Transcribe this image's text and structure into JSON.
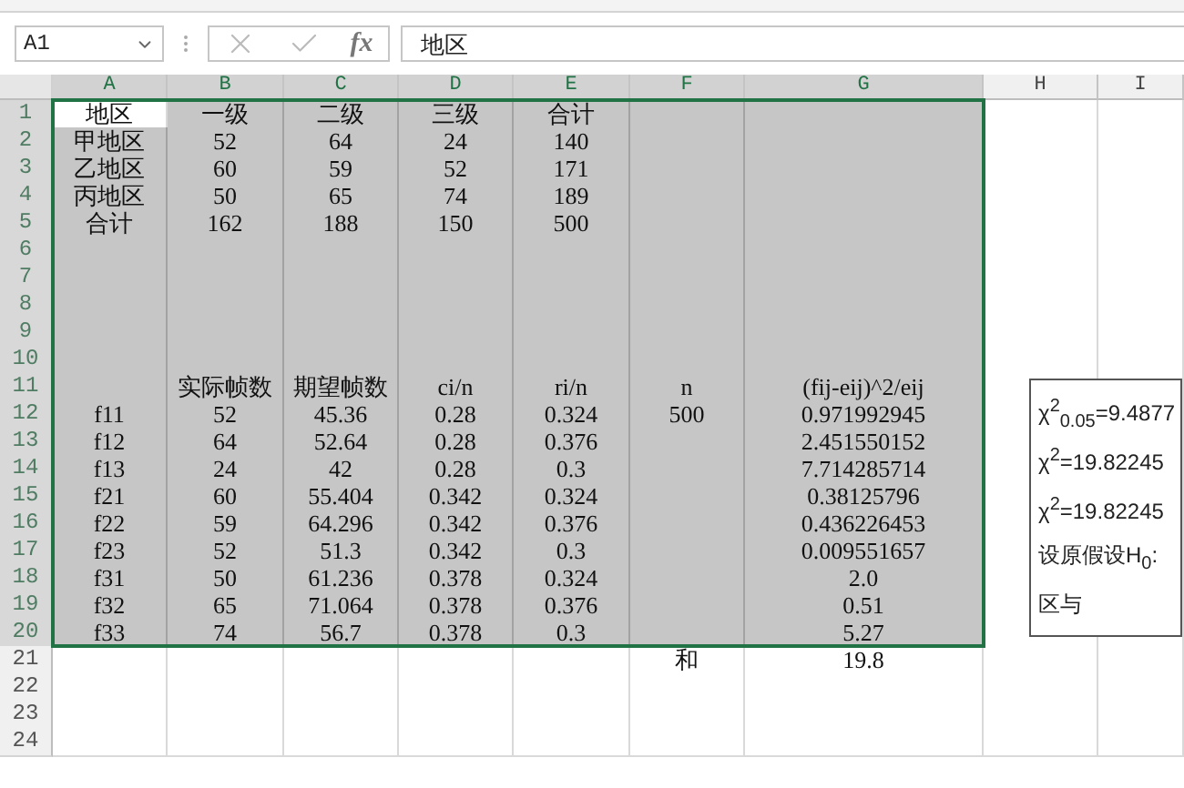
{
  "formula_bar": {
    "name_box": "A1",
    "fx_label": "fx",
    "formula": "地区"
  },
  "columns": [
    {
      "label": "A",
      "selected": true,
      "active": true
    },
    {
      "label": "B",
      "selected": true,
      "active": false
    },
    {
      "label": "C",
      "selected": true,
      "active": false
    },
    {
      "label": "D",
      "selected": true,
      "active": false
    },
    {
      "label": "E",
      "selected": true,
      "active": false
    },
    {
      "label": "F",
      "selected": true,
      "active": false
    },
    {
      "label": "G",
      "selected": true,
      "active": false
    },
    {
      "label": "H",
      "selected": false,
      "active": false
    },
    {
      "label": "I",
      "selected": false,
      "active": false
    }
  ],
  "rows": [
    {
      "number": "1",
      "selected": true,
      "active": true,
      "cells": {
        "A": "地区",
        "B": "一级",
        "C": "二级",
        "D": "三级",
        "E": "合计"
      }
    },
    {
      "number": "2",
      "selected": true,
      "cells": {
        "A": "甲地区",
        "B": "52",
        "C": "64",
        "D": "24",
        "E": "140"
      }
    },
    {
      "number": "3",
      "selected": true,
      "cells": {
        "A": "乙地区",
        "B": "60",
        "C": "59",
        "D": "52",
        "E": "171"
      }
    },
    {
      "number": "4",
      "selected": true,
      "cells": {
        "A": "丙地区",
        "B": "50",
        "C": "65",
        "D": "74",
        "E": "189"
      }
    },
    {
      "number": "5",
      "selected": true,
      "cells": {
        "A": "合计",
        "B": "162",
        "C": "188",
        "D": "150",
        "E": "500"
      }
    },
    {
      "number": "6",
      "selected": true,
      "cells": {}
    },
    {
      "number": "7",
      "selected": true,
      "cells": {}
    },
    {
      "number": "8",
      "selected": true,
      "cells": {}
    },
    {
      "number": "9",
      "selected": true,
      "cells": {}
    },
    {
      "number": "10",
      "selected": true,
      "cells": {}
    },
    {
      "number": "11",
      "selected": true,
      "cells": {
        "B": "实际帧数",
        "C": "期望帧数",
        "D": "ci/n",
        "E": "ri/n",
        "F": "n",
        "G": "(fij-eij)^2/eij"
      }
    },
    {
      "number": "12",
      "selected": true,
      "cells": {
        "A": "f11",
        "B": "52",
        "C": "45.36",
        "D": "0.28",
        "E": "0.324",
        "F": "500",
        "G": "0.971992945"
      }
    },
    {
      "number": "13",
      "selected": true,
      "cells": {
        "A": "f12",
        "B": "64",
        "C": "52.64",
        "D": "0.28",
        "E": "0.376",
        "G": "2.451550152"
      }
    },
    {
      "number": "14",
      "selected": true,
      "cells": {
        "A": "f13",
        "B": "24",
        "C": "42",
        "D": "0.28",
        "E": "0.3",
        "G": "7.714285714"
      }
    },
    {
      "number": "15",
      "selected": true,
      "cells": {
        "A": "f21",
        "B": "60",
        "C": "55.404",
        "D": "0.342",
        "E": "0.324",
        "G": "0.38125796"
      }
    },
    {
      "number": "16",
      "selected": true,
      "cells": {
        "A": "f22",
        "B": "59",
        "C": "64.296",
        "D": "0.342",
        "E": "0.376",
        "G": "0.436226453"
      }
    },
    {
      "number": "17",
      "selected": true,
      "cells": {
        "A": "f23",
        "B": "52",
        "C": "51.3",
        "D": "0.342",
        "E": "0.3",
        "G": "0.009551657"
      }
    },
    {
      "number": "18",
      "selected": true,
      "cells": {
        "A": "f31",
        "B": "50",
        "C": "61.236",
        "D": "0.378",
        "E": "0.324",
        "G": "2.0"
      }
    },
    {
      "number": "19",
      "selected": true,
      "cells": {
        "A": "f32",
        "B": "65",
        "C": "71.064",
        "D": "0.378",
        "E": "0.376",
        "G": "0.51"
      }
    },
    {
      "number": "20",
      "selected": true,
      "cells": {
        "A": "f33",
        "B": "74",
        "C": "56.7",
        "D": "0.378",
        "E": "0.3",
        "G": "5.27"
      }
    },
    {
      "number": "21",
      "selected": false,
      "cells": {
        "F": "和",
        "G": "19.8"
      }
    },
    {
      "number": "22",
      "selected": false,
      "cells": {}
    },
    {
      "number": "23",
      "selected": false,
      "cells": {}
    },
    {
      "number": "24",
      "selected": false,
      "cells": {}
    }
  ],
  "text_box": {
    "lines": [
      "χ$^{2}$$_{0.05}$=9.4877",
      "χ$^{2}$=19.82245",
      "χ$^{2}$=19.82245",
      "设原假设H$_{0}$:",
      "区与"
    ]
  }
}
